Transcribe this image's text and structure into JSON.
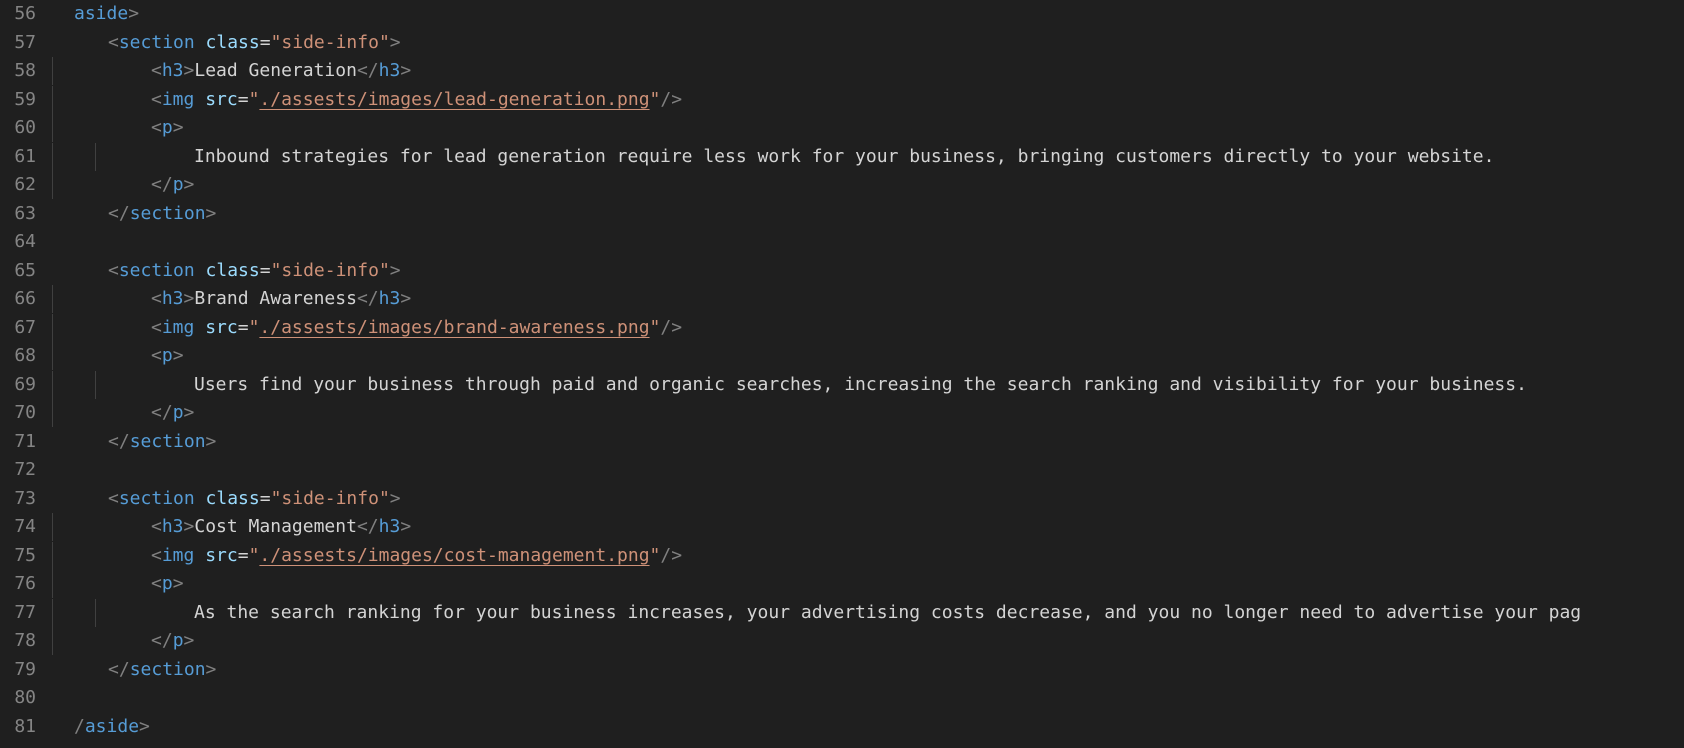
{
  "editor": {
    "lines": [
      {
        "num": "56",
        "indent": 0,
        "guides": [],
        "tokens": [
          [
            "tag",
            "aside"
          ],
          [
            "punct",
            ">"
          ]
        ]
      },
      {
        "num": "57",
        "indent": 1,
        "guides": [],
        "tokens": [
          [
            "punct",
            "<"
          ],
          [
            "tag",
            "section"
          ],
          [
            "txt",
            " "
          ],
          [
            "attr",
            "class"
          ],
          [
            "txt",
            "="
          ],
          [
            "str",
            "\"side-info\""
          ],
          [
            "punct",
            ">"
          ]
        ]
      },
      {
        "num": "58",
        "indent": 2,
        "guides": [
          1
        ],
        "tokens": [
          [
            "punct",
            "<"
          ],
          [
            "tag",
            "h3"
          ],
          [
            "punct",
            ">"
          ],
          [
            "txt",
            "Lead Generation"
          ],
          [
            "punct",
            "</"
          ],
          [
            "tag",
            "h3"
          ],
          [
            "punct",
            ">"
          ]
        ]
      },
      {
        "num": "59",
        "indent": 2,
        "guides": [
          1
        ],
        "tokens": [
          [
            "punct",
            "<"
          ],
          [
            "tag",
            "img"
          ],
          [
            "txt",
            " "
          ],
          [
            "attr",
            "src"
          ],
          [
            "txt",
            "="
          ],
          [
            "str",
            "\""
          ],
          [
            "link",
            "./assests/images/lead-generation.png"
          ],
          [
            "str",
            "\""
          ],
          [
            "punct",
            "/>"
          ]
        ]
      },
      {
        "num": "60",
        "indent": 2,
        "guides": [
          1
        ],
        "tokens": [
          [
            "punct",
            "<"
          ],
          [
            "tag",
            "p"
          ],
          [
            "punct",
            ">"
          ]
        ]
      },
      {
        "num": "61",
        "indent": 3,
        "guides": [
          1,
          2
        ],
        "tokens": [
          [
            "txt",
            "Inbound strategies for lead generation require less work for your business, bringing customers directly to your website."
          ]
        ]
      },
      {
        "num": "62",
        "indent": 2,
        "guides": [
          1
        ],
        "tokens": [
          [
            "punct",
            "</"
          ],
          [
            "tag",
            "p"
          ],
          [
            "punct",
            ">"
          ]
        ]
      },
      {
        "num": "63",
        "indent": 1,
        "guides": [],
        "tokens": [
          [
            "punct",
            "</"
          ],
          [
            "tag",
            "section"
          ],
          [
            "punct",
            ">"
          ]
        ]
      },
      {
        "num": "64",
        "indent": 0,
        "guides": [],
        "tokens": []
      },
      {
        "num": "65",
        "indent": 1,
        "guides": [],
        "tokens": [
          [
            "punct",
            "<"
          ],
          [
            "tag",
            "section"
          ],
          [
            "txt",
            " "
          ],
          [
            "attr",
            "class"
          ],
          [
            "txt",
            "="
          ],
          [
            "str",
            "\"side-info\""
          ],
          [
            "punct",
            ">"
          ]
        ]
      },
      {
        "num": "66",
        "indent": 2,
        "guides": [
          1
        ],
        "tokens": [
          [
            "punct",
            "<"
          ],
          [
            "tag",
            "h3"
          ],
          [
            "punct",
            ">"
          ],
          [
            "txt",
            "Brand Awareness"
          ],
          [
            "punct",
            "</"
          ],
          [
            "tag",
            "h3"
          ],
          [
            "punct",
            ">"
          ]
        ]
      },
      {
        "num": "67",
        "indent": 2,
        "guides": [
          1
        ],
        "tokens": [
          [
            "punct",
            "<"
          ],
          [
            "tag",
            "img"
          ],
          [
            "txt",
            " "
          ],
          [
            "attr",
            "src"
          ],
          [
            "txt",
            "="
          ],
          [
            "str",
            "\""
          ],
          [
            "link",
            "./assests/images/brand-awareness.png"
          ],
          [
            "str",
            "\""
          ],
          [
            "punct",
            "/>"
          ]
        ]
      },
      {
        "num": "68",
        "indent": 2,
        "guides": [
          1
        ],
        "tokens": [
          [
            "punct",
            "<"
          ],
          [
            "tag",
            "p"
          ],
          [
            "punct",
            ">"
          ]
        ]
      },
      {
        "num": "69",
        "indent": 3,
        "guides": [
          1,
          2
        ],
        "tokens": [
          [
            "txt",
            "Users find your business through paid and organic searches, increasing the search ranking and visibility for your business."
          ]
        ]
      },
      {
        "num": "70",
        "indent": 2,
        "guides": [
          1
        ],
        "tokens": [
          [
            "punct",
            "</"
          ],
          [
            "tag",
            "p"
          ],
          [
            "punct",
            ">"
          ]
        ]
      },
      {
        "num": "71",
        "indent": 1,
        "guides": [],
        "tokens": [
          [
            "punct",
            "</"
          ],
          [
            "tag",
            "section"
          ],
          [
            "punct",
            ">"
          ]
        ]
      },
      {
        "num": "72",
        "indent": 0,
        "guides": [],
        "tokens": []
      },
      {
        "num": "73",
        "indent": 1,
        "guides": [],
        "tokens": [
          [
            "punct",
            "<"
          ],
          [
            "tag",
            "section"
          ],
          [
            "txt",
            " "
          ],
          [
            "attr",
            "class"
          ],
          [
            "txt",
            "="
          ],
          [
            "str",
            "\"side-info\""
          ],
          [
            "punct",
            ">"
          ]
        ]
      },
      {
        "num": "74",
        "indent": 2,
        "guides": [
          1
        ],
        "tokens": [
          [
            "punct",
            "<"
          ],
          [
            "tag",
            "h3"
          ],
          [
            "punct",
            ">"
          ],
          [
            "txt",
            "Cost Management"
          ],
          [
            "punct",
            "</"
          ],
          [
            "tag",
            "h3"
          ],
          [
            "punct",
            ">"
          ]
        ]
      },
      {
        "num": "75",
        "indent": 2,
        "guides": [
          1
        ],
        "tokens": [
          [
            "punct",
            "<"
          ],
          [
            "tag",
            "img"
          ],
          [
            "txt",
            " "
          ],
          [
            "attr",
            "src"
          ],
          [
            "txt",
            "="
          ],
          [
            "str",
            "\""
          ],
          [
            "link",
            "./assests/images/cost-management.png"
          ],
          [
            "str",
            "\""
          ],
          [
            "punct",
            "/>"
          ]
        ]
      },
      {
        "num": "76",
        "indent": 2,
        "guides": [
          1
        ],
        "tokens": [
          [
            "punct",
            "<"
          ],
          [
            "tag",
            "p"
          ],
          [
            "punct",
            ">"
          ]
        ]
      },
      {
        "num": "77",
        "indent": 3,
        "guides": [
          1,
          2
        ],
        "tokens": [
          [
            "txt",
            "As the search ranking for your business increases, your advertising costs decrease, and you no longer need to advertise your pag"
          ]
        ]
      },
      {
        "num": "78",
        "indent": 2,
        "guides": [
          1
        ],
        "tokens": [
          [
            "punct",
            "</"
          ],
          [
            "tag",
            "p"
          ],
          [
            "punct",
            ">"
          ]
        ]
      },
      {
        "num": "79",
        "indent": 1,
        "guides": [],
        "tokens": [
          [
            "punct",
            "</"
          ],
          [
            "tag",
            "section"
          ],
          [
            "punct",
            ">"
          ]
        ]
      },
      {
        "num": "80",
        "indent": 0,
        "guides": [],
        "tokens": []
      },
      {
        "num": "81",
        "indent": 0,
        "guides": [],
        "tokens": [
          [
            "punct",
            "/"
          ],
          [
            "tag",
            "aside"
          ],
          [
            "punct",
            ">"
          ]
        ]
      }
    ]
  }
}
